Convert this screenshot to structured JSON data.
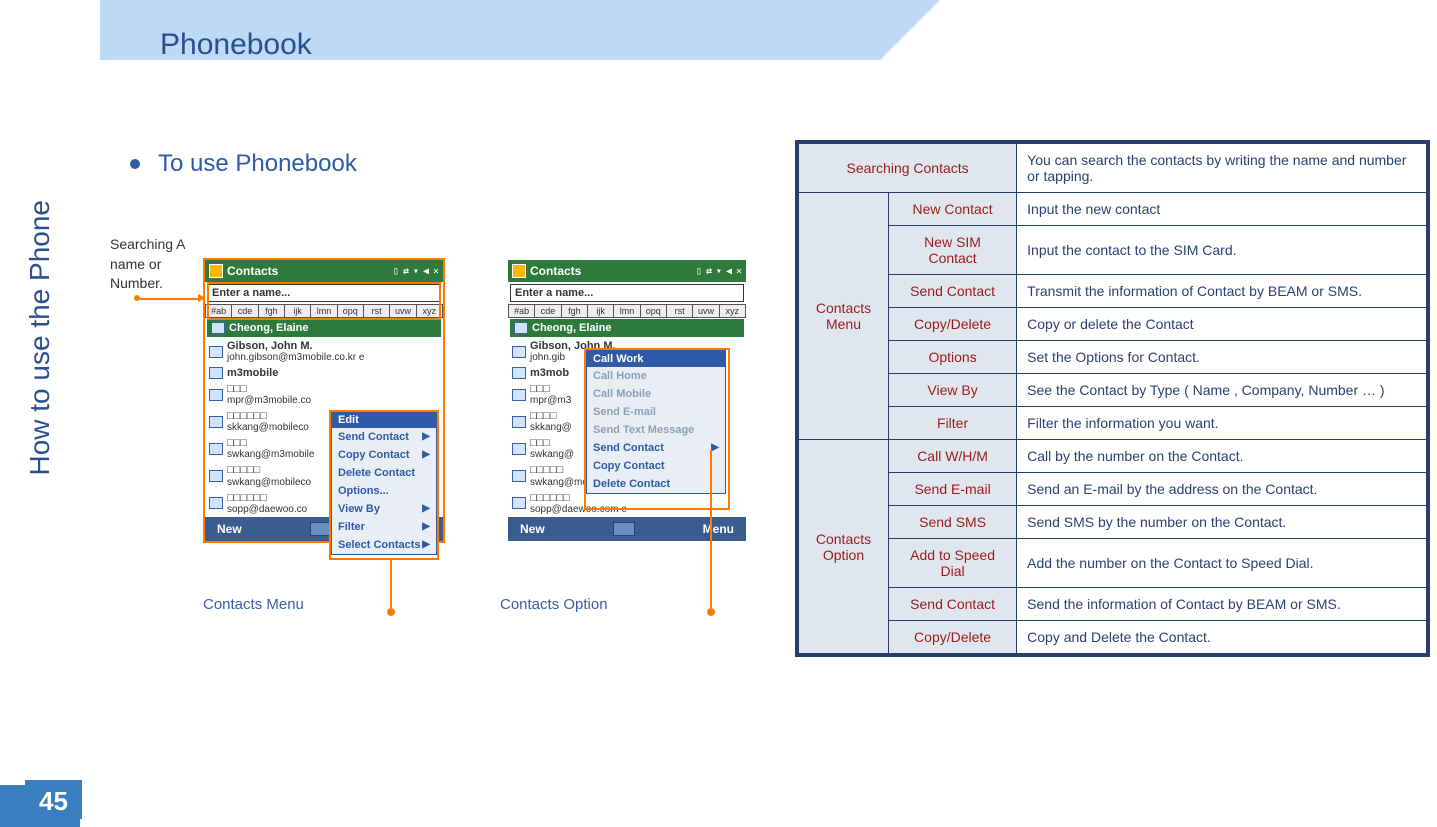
{
  "pageTitle": "Phonebook",
  "sideLabel": "How to use the Phone",
  "bulletText": "To use Phonebook",
  "searchCallout": "Searching A name or Number.",
  "cap1": "Contacts Menu",
  "cap2": "Contacts Option",
  "pageNumber": "45",
  "phone": {
    "titleBar": "Contacts",
    "searchPlaceholder": "Enter a name...",
    "tabs": [
      "#ab",
      "cde",
      "fgh",
      "ijk",
      "lmn",
      "opq",
      "rst",
      "uvw",
      "xyz"
    ],
    "highlight": "Cheong, Elaine",
    "rows": [
      {
        "name": "Gibson, John M.",
        "sub": "john.gibson@m3mobile.co.kr   e"
      },
      {
        "name": "m3mobile",
        "sub": ""
      },
      {
        "name": "□□□",
        "sub": "mpr@m3mobile.co"
      },
      {
        "name": "□□□□□□",
        "sub": "skkang@mobileco"
      },
      {
        "name": "□□□",
        "sub": "swkang@m3mobile"
      },
      {
        "name": "□□□□□",
        "sub": "swkang@mobileco"
      },
      {
        "name": "□□□□□□",
        "sub": "sopp@daewoo.co"
      }
    ],
    "bottomLeft": "New",
    "bottomRight": "Menu",
    "floatMenu": {
      "head": "Edit",
      "items": [
        {
          "label": "Send Contact",
          "arrow": true
        },
        {
          "label": "Copy Contact",
          "arrow": true
        },
        {
          "label": "Delete Contact",
          "arrow": false
        },
        {
          "label": "Options...",
          "arrow": false
        },
        {
          "label": "View By",
          "arrow": true
        },
        {
          "label": "Filter",
          "arrow": true
        },
        {
          "label": "Select Contacts",
          "arrow": true
        }
      ]
    },
    "floatSub": {
      "head": "Call Work",
      "items": [
        {
          "label": "Call Home",
          "active": false
        },
        {
          "label": "Call Mobile",
          "active": false
        },
        {
          "label": "Send E-mail",
          "active": false
        },
        {
          "label": "Send Text Message",
          "active": false
        },
        {
          "label": "Send Contact",
          "active": true,
          "arrow": true
        },
        {
          "label": "Copy Contact",
          "active": true
        },
        {
          "label": "Delete Contact",
          "active": true
        }
      ]
    },
    "rows2sub6": "sopp@daewoo.com   e"
  },
  "refTable": {
    "row0": {
      "hdr": "Searching Contacts",
      "desc": "You can search the contacts by writing  the name and number or tapping."
    },
    "group1": "Contacts Menu",
    "g1rows": [
      {
        "hdr": "New Contact",
        "desc": "Input the new contact"
      },
      {
        "hdr": "New SIM Contact",
        "desc": "Input the contact to the SIM Card."
      },
      {
        "hdr": "Send Contact",
        "desc": "Transmit the information of Contact by BEAM or SMS."
      },
      {
        "hdr": "Copy/Delete",
        "desc": "Copy or delete the Contact"
      },
      {
        "hdr": "Options",
        "desc": "Set the Options for Contact."
      },
      {
        "hdr": "View By",
        "desc": "See the Contact by Type ( Name , Company, Number … )"
      },
      {
        "hdr": "Filter",
        "desc": "Filter the information you want."
      }
    ],
    "group2": "Contacts Option",
    "g2rows": [
      {
        "hdr": "Call W/H/M",
        "desc": "Call by the number on the Contact."
      },
      {
        "hdr": "Send E-mail",
        "desc": "Send an E-mail by the address on the Contact."
      },
      {
        "hdr": "Send SMS",
        "desc": "Send SMS  by the number  on the Contact."
      },
      {
        "hdr": "Add to Speed Dial",
        "desc": "Add the number on the Contact to Speed Dial."
      },
      {
        "hdr": "Send Contact",
        "desc": "Send the information of Contact by BEAM or SMS."
      },
      {
        "hdr": "Copy/Delete",
        "desc": "Copy and Delete the Contact."
      }
    ]
  }
}
